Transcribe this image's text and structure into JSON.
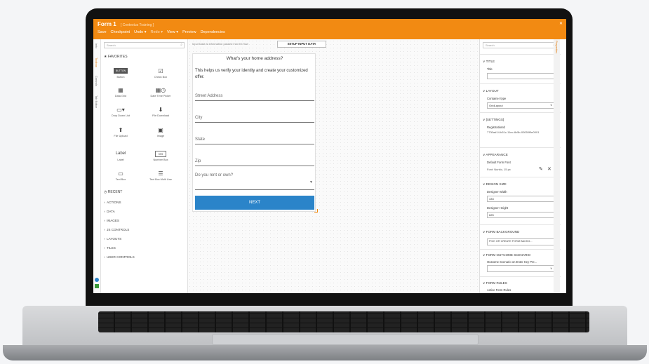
{
  "app": {
    "form_title": "Form 1",
    "form_subtitle": "[ Contextus Training ]",
    "menu": [
      "Save",
      "Checkpoint",
      "Undo ▾",
      "Redo ▾",
      "View ▾",
      "Preview",
      "Dependencies"
    ]
  },
  "left_strip": [
    "Info",
    "Toolbox",
    "Controls",
    "Tab Editor"
  ],
  "toolbox": {
    "search_placeholder": "Search",
    "favorites_label": "FAVORITES",
    "tools": [
      {
        "label": "Button",
        "glyph": "BUTTON"
      },
      {
        "label": "Check Box",
        "glyph": "☑"
      },
      {
        "label": "Data Grid",
        "glyph": "▦"
      },
      {
        "label": "Date Time Picker",
        "glyph": "▦◷"
      },
      {
        "label": "Drop Down List",
        "glyph": "▭▾"
      },
      {
        "label": "File Download",
        "glyph": "⬇"
      },
      {
        "label": "File Upload",
        "glyph": "⬆"
      },
      {
        "label": "Image",
        "glyph": "▣"
      },
      {
        "label": "Label",
        "glyph": "Label"
      },
      {
        "label": "Number Box",
        "glyph": "999"
      },
      {
        "label": "Text Box",
        "glyph": "▭"
      },
      {
        "label": "Text Box Multi Line",
        "glyph": "☰"
      }
    ],
    "recent_label": "RECENT",
    "tree": [
      "ACTIONS",
      "DATA",
      "IMAGES",
      "JS CONTROLS",
      "LAYOUTS",
      "TILES",
      "USER CONTROLS"
    ]
  },
  "canvas": {
    "hint": "Input Data is information passed into the flow",
    "setup_button": "SETUP INPUT DATA",
    "question": "What's your home address?",
    "description": "This helps us verify your identity and create your customized offer.",
    "fields": [
      "Street Address",
      "City",
      "State",
      "Zip",
      "Do you rent or own?"
    ],
    "next_button": "NEXT"
  },
  "properties": {
    "search_placeholder": "Search",
    "side_tab": "Properties",
    "title_section": "TITLE",
    "title_label": "Title",
    "layout_section": "LAYOUT",
    "container_label": "Container type",
    "container_value": "GridLayout",
    "settings_section": "[SETTINGS]",
    "registration_label": "RegistrationId",
    "registration_value": "7730ad14-b51c-11ec-8c5b-00050f9e0001",
    "appearance_section": "APPEARANCE",
    "font_label": "Default Form Font",
    "font_value": "Font: Nunito, 15 px",
    "design_section": "DESIGN SIZE",
    "width_label": "Designer Width",
    "width_value": "433",
    "height_label": "Designer Height",
    "height_value": "625",
    "background_section": "FORM BACKGROUND",
    "background_button": "PICK OR CREATE FORM BACKG...",
    "outcome_section": "FORM OUTCOME SCENARIO",
    "outcome_label": "Outcome Scenario on Enter Key Pre...",
    "rules_section": "FORM RULES",
    "rules_label": "Active Form Rules"
  }
}
